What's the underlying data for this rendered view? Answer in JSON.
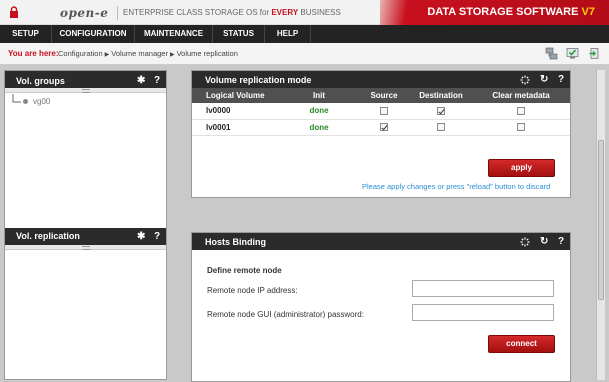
{
  "header": {
    "brand": "open-e",
    "tagline_prefix": "ENTERPRISE CLASS STORAGE OS for ",
    "tagline_highlight": "EVERY",
    "tagline_suffix": " BUSINESS",
    "product_name": "DATA STORAGE SOFTWARE ",
    "product_version": "V7",
    "lock_icon": "lock-icon"
  },
  "menu": {
    "items": [
      "SETUP",
      "CONFIGURATION",
      "MAINTENANCE",
      "STATUS",
      "HELP"
    ]
  },
  "breadcrumb": {
    "prefix": "You are here:",
    "items": [
      "Configuration",
      "Volume manager",
      "Volume replication"
    ],
    "toolbar_icons": [
      "network-icon",
      "monitor-check-icon",
      "logout-icon"
    ]
  },
  "left": {
    "vol_groups": {
      "title": "Vol. groups",
      "tree": [
        "vg00"
      ]
    },
    "vol_replication": {
      "title": "Vol. replication"
    }
  },
  "replication_mode": {
    "title": "Volume replication mode",
    "columns": [
      "Logical Volume",
      "Init",
      "Source",
      "Destination",
      "Clear metadata"
    ],
    "rows": [
      {
        "volume": "lv0000",
        "init": "done",
        "source": false,
        "destination": true,
        "clear_metadata": false
      },
      {
        "volume": "lv0001",
        "init": "done",
        "source": true,
        "destination": false,
        "clear_metadata": false
      }
    ],
    "apply_label": "apply",
    "note": "Please apply changes or press \"reload\" button to discard"
  },
  "hosts_binding": {
    "title": "Hosts Binding",
    "section_title": "Define remote node",
    "ip_label": "Remote node IP address:",
    "ip_value": "",
    "password_label": "Remote node GUI (administrator) password:",
    "password_value": "",
    "connect_label": "connect"
  },
  "colors": {
    "accent_red": "#c8101e",
    "done_green": "#2a8a2a",
    "note_blue": "#2a8fd6",
    "header_dark": "#2b2b2b"
  }
}
